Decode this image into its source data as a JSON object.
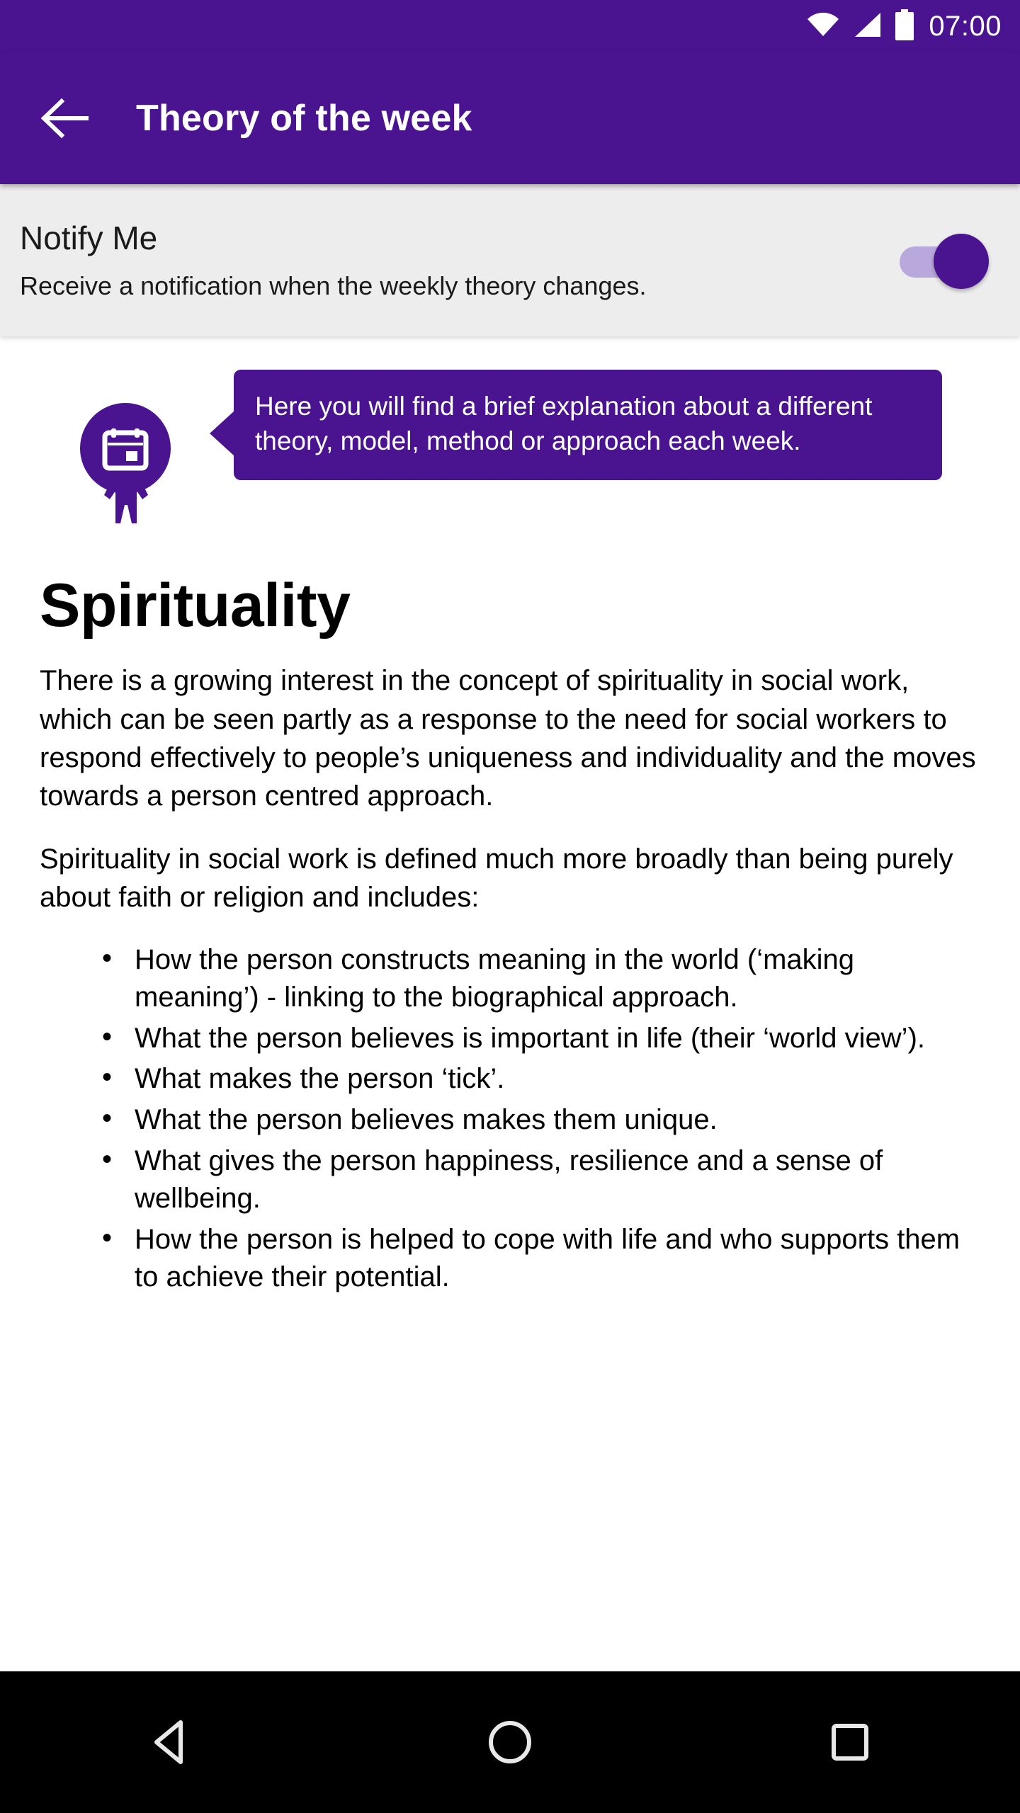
{
  "status_bar": {
    "time": "07:00",
    "icons": [
      "wifi-icon",
      "cellular-signal-icon",
      "battery-icon"
    ]
  },
  "app_bar": {
    "back_label": "back-arrow",
    "title": "Theory of the week",
    "background_color": "#4A1490",
    "text_color": "#FFFFFF"
  },
  "notify_section": {
    "title": "Notify Me",
    "subtitle": "Receive a notification when the weekly theory changes.",
    "toggle": {
      "state": "on",
      "track_color": "#B9A8DB",
      "thumb_color": "#4A1490"
    },
    "background_color": "#EDEDED"
  },
  "tooltip": {
    "icon": "calendar-icon",
    "text": "Here you will find a brief explanation about a different theory, model, method or approach each week.",
    "background_color": "#4A1490",
    "text_color": "#FFFFFF"
  },
  "article": {
    "title": "Spirituality",
    "paragraphs": [
      "There is a growing interest in the concept of spirituality in social work, which can be seen partly as a response to the need for social workers to respond effectively to people’s uniqueness and individuality and the moves towards a person centred approach.",
      "Spirituality in social work is defined much more broadly than being purely about faith or religion and includes:"
    ],
    "bullets": [
      "How the person constructs meaning in the world (‘making meaning’) - linking to the biographical approach.",
      "What the person believes is important in life (their ‘world view’).",
      "What makes the person ‘tick’.",
      "What the person believes makes them unique.",
      "What gives the person happiness, resilience and a sense of wellbeing.",
      "How the person is helped to cope with life and who supports them to achieve their potential."
    ]
  },
  "nav_bar": {
    "back": "nav-back-triangle",
    "home": "nav-home-circle",
    "recents": "nav-recents-square",
    "background_color": "#000000"
  }
}
